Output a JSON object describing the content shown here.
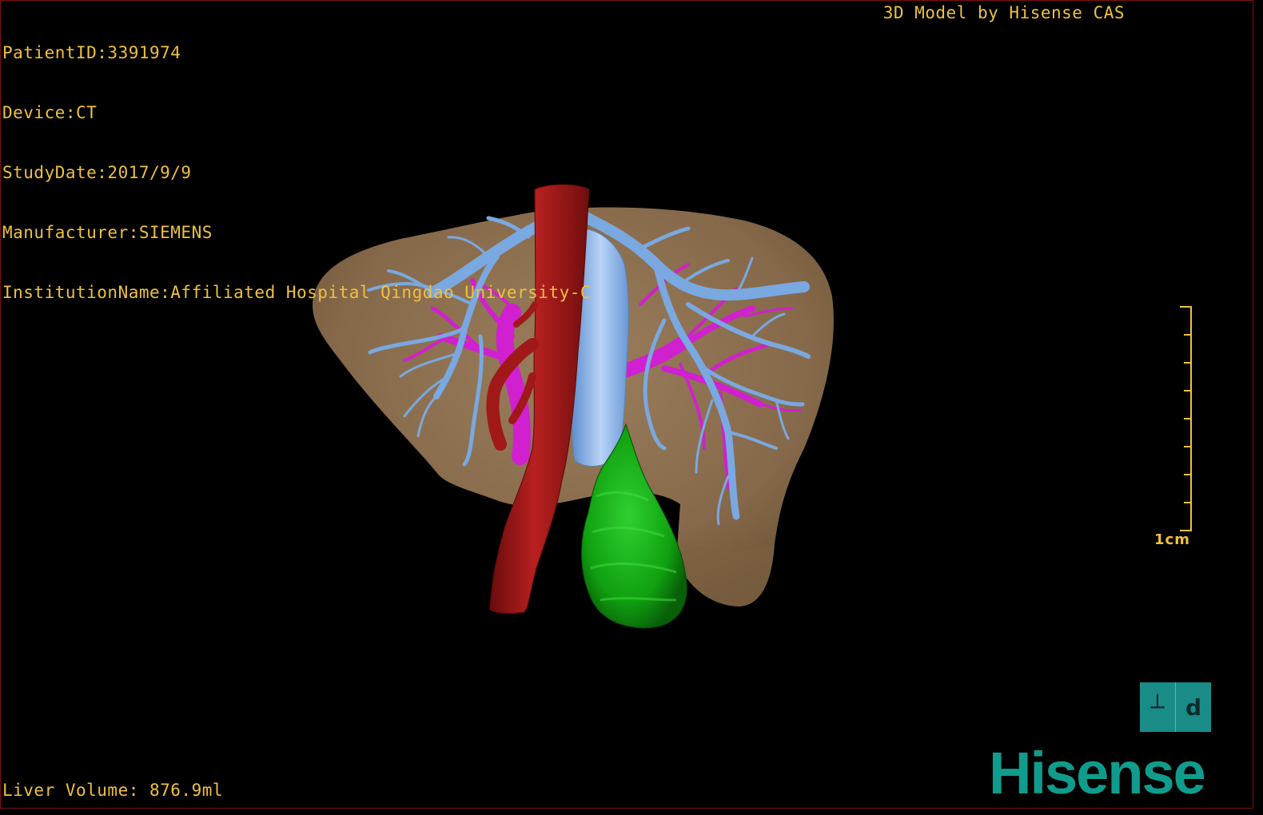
{
  "info": {
    "patient_id": "PatientID:3391974",
    "device": "Device:CT",
    "study_date": "StudyDate:2017/9/9",
    "manufacturer": "Manufacturer:SIEMENS",
    "institution": "InstitutionName:Affiliated Hospital Qingdao University-C"
  },
  "credit": "3D Model by Hisense CAS",
  "liver_volume": "Liver Volume: 876.9ml",
  "scale": {
    "label": "1cm",
    "ticks": 9
  },
  "view_cube": {
    "left_face": "┴",
    "right_face": "d"
  },
  "logo": "Hisense",
  "colors": {
    "overlay_text": "#f0c040",
    "liver": "#8a7050",
    "vena_cava": "#a01818",
    "hepatic_veins": "#7aa8e0",
    "portal_vein": "#d020d0",
    "gallbladder": "#10a010",
    "logo": "#109c8c",
    "view_cube": "#1a8c88"
  }
}
